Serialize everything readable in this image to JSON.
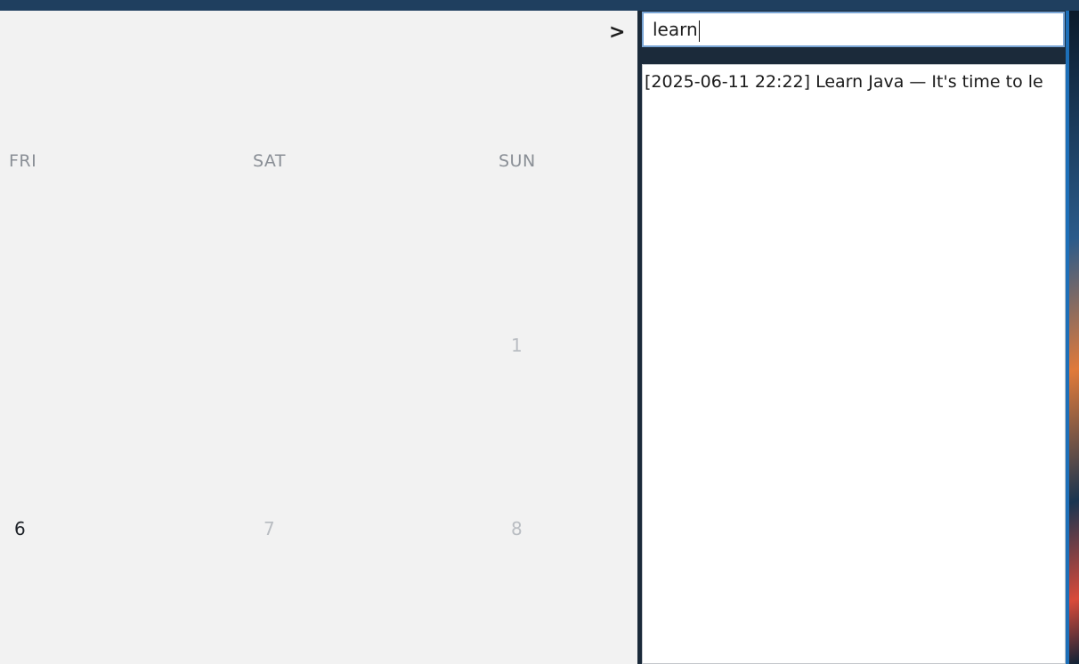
{
  "calendar": {
    "day_headers": [
      "FRI",
      "SAT",
      "SUN"
    ],
    "row1": {
      "sun": "1"
    },
    "row2": {
      "fri": "6",
      "sat": "7",
      "sun": "8"
    }
  },
  "search": {
    "prompt": ">",
    "value": "learn"
  },
  "results": [
    {
      "text": "[2025-06-11 22:22] Learn Java — It's time to le"
    }
  ],
  "colors": {
    "accent": "#7aa6d6",
    "window_edge": "#1d6fb8"
  }
}
